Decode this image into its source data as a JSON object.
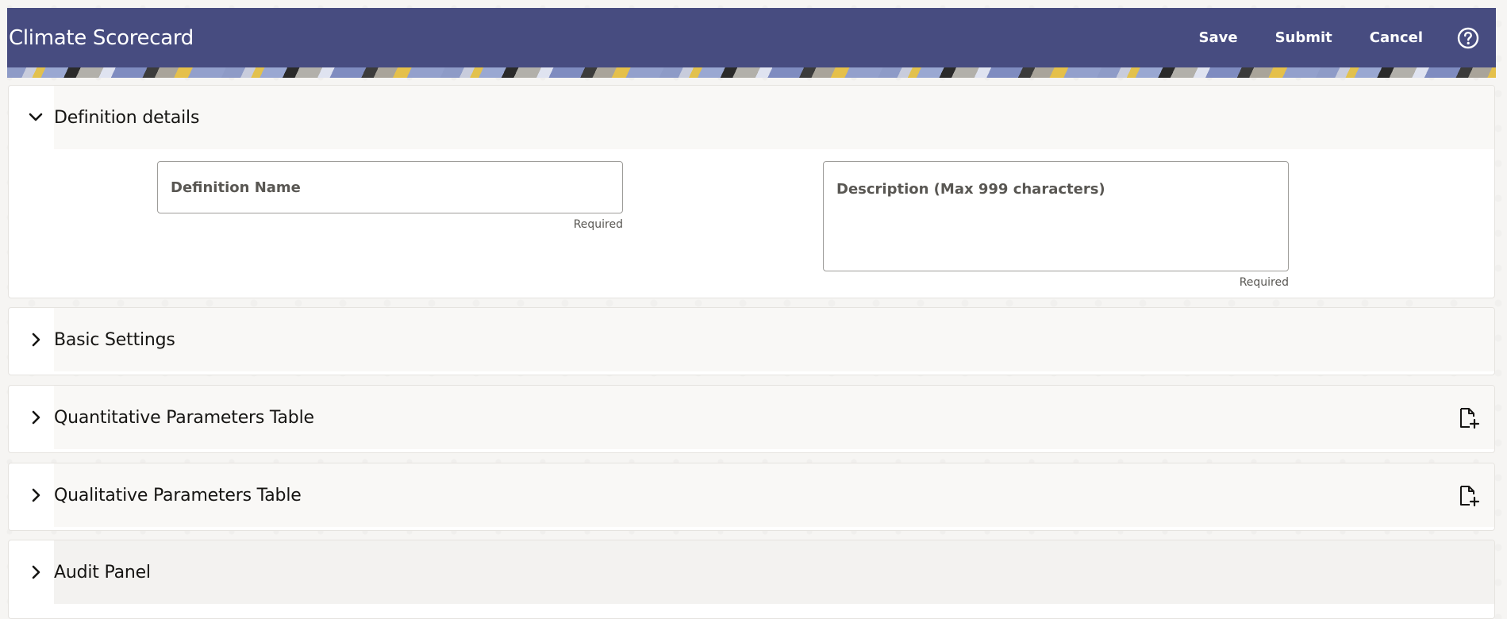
{
  "header": {
    "title": "Climate Scorecard",
    "save_label": "Save",
    "submit_label": "Submit",
    "cancel_label": "Cancel",
    "help_icon": "question-circle-icon"
  },
  "panels": {
    "definition": {
      "title": "Definition details",
      "expanded": true,
      "name_placeholder": "Definition Name",
      "name_value": "",
      "name_required": "Required",
      "description_placeholder": "Description (Max 999 characters)",
      "description_value": "",
      "description_required": "Required"
    },
    "basic": {
      "title": "Basic Settings",
      "expanded": false
    },
    "quantitative": {
      "title": "Quantitative Parameters Table",
      "expanded": false,
      "action_icon": "add-file-icon"
    },
    "qualitative": {
      "title": "Qualitative Parameters Table",
      "expanded": false,
      "action_icon": "add-file-icon"
    },
    "audit": {
      "title": "Audit Panel",
      "expanded": false
    }
  },
  "colors": {
    "header_background": "#474c80",
    "panel_header_background": "#f9f8f6",
    "page_background": "#f6f5f3",
    "text": "#161513"
  }
}
